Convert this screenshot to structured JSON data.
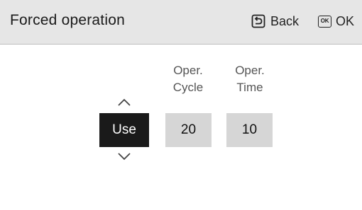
{
  "header": {
    "title": "Forced operation",
    "back_label": "Back",
    "ok_icon_text": "OK",
    "ok_label": "OK"
  },
  "columns": {
    "cycle_label_line1": "Oper.",
    "cycle_label_line2": "Cycle",
    "time_label_line1": "Oper.",
    "time_label_line2": "Time"
  },
  "values": {
    "use": "Use",
    "cycle": "20",
    "time": "10"
  },
  "icons": {
    "back": "back-arrow-icon",
    "ok": "ok-key-icon",
    "up": "chevron-up-icon",
    "down": "chevron-down-icon"
  },
  "colors": {
    "header_bg": "#e6e6e6",
    "selected_bg": "#1a1a1a",
    "unselected_bg": "#d6d6d6",
    "label_text": "#555555"
  }
}
